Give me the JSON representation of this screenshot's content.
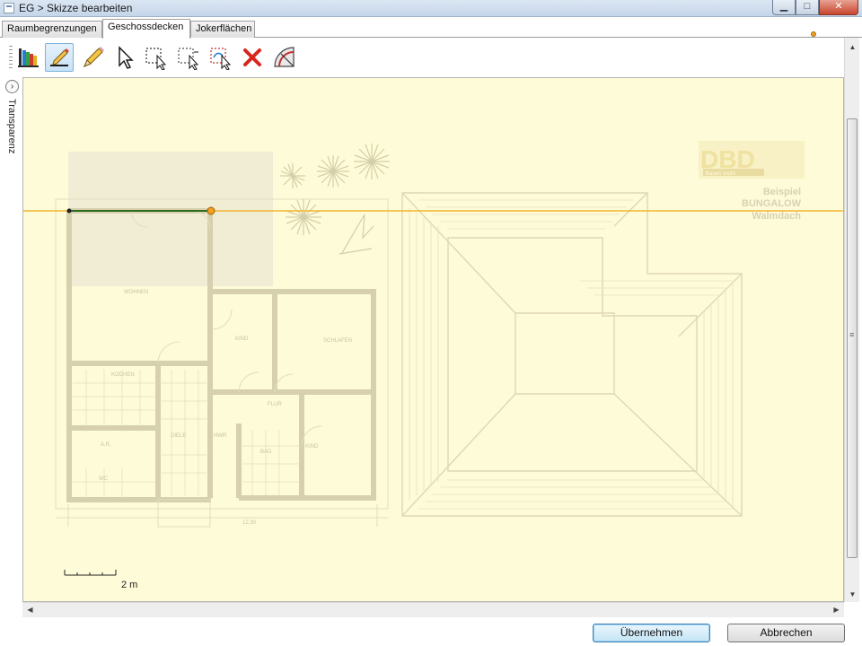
{
  "window": {
    "title": "EG > Skizze bearbeiten",
    "controls": {
      "minimize": "▁",
      "maximize": "□",
      "close": "✕"
    }
  },
  "tabs": [
    {
      "label": "Raumbegrenzungen",
      "active": false
    },
    {
      "label": "Geschossdecken",
      "active": true
    },
    {
      "label": "Jokerflächen",
      "active": false
    }
  ],
  "toolbar": {
    "tools": [
      {
        "name": "layers-tool",
        "icon": "color-bars-icon"
      },
      {
        "name": "draw-line-tool",
        "icon": "pen-line-icon",
        "selected": true
      },
      {
        "name": "pencil-tool",
        "icon": "pencil-icon"
      },
      {
        "name": "select-tool",
        "icon": "cursor-arrow-icon"
      },
      {
        "name": "rect-select-tool",
        "icon": "dashed-rect-cursor-icon"
      },
      {
        "name": "rect-select-alt-tool",
        "icon": "dashed-rect-cursor-icon"
      },
      {
        "name": "move-select-tool",
        "icon": "dashed-rect-move-icon"
      },
      {
        "name": "delete-tool",
        "icon": "red-x-icon"
      },
      {
        "name": "measure-tool",
        "icon": "protractor-icon"
      }
    ]
  },
  "left_panel": {
    "expand_icon": "›",
    "label": "Transparenz"
  },
  "canvas": {
    "background_color": "#fefbd8",
    "guide_line_color": "#f2b430",
    "sketch_line_color": "#2d6a1e",
    "plan_line_color": "#d8d2b0",
    "room_labels": [
      "WOHNEN",
      "KIND",
      "SCHLAFEN",
      "KOCHEN",
      "FLUR",
      "DIELE",
      "A.R.",
      "HWR",
      "BAD",
      "KIND",
      "WC"
    ],
    "dimension_label": "12,30",
    "logo_text": "DBD",
    "logo_subtext": "Bauen leicht",
    "caption_lines": [
      "Beispiel",
      "BUNGALOW",
      "Walmdach"
    ],
    "scale_label": "2 m"
  },
  "scrollbars": {
    "up_arrow": "▲",
    "down_arrow": "▼",
    "left_arrow": "◀",
    "right_arrow": "▶"
  },
  "buttons": {
    "apply": "Übernehmen",
    "cancel": "Abbrechen"
  }
}
